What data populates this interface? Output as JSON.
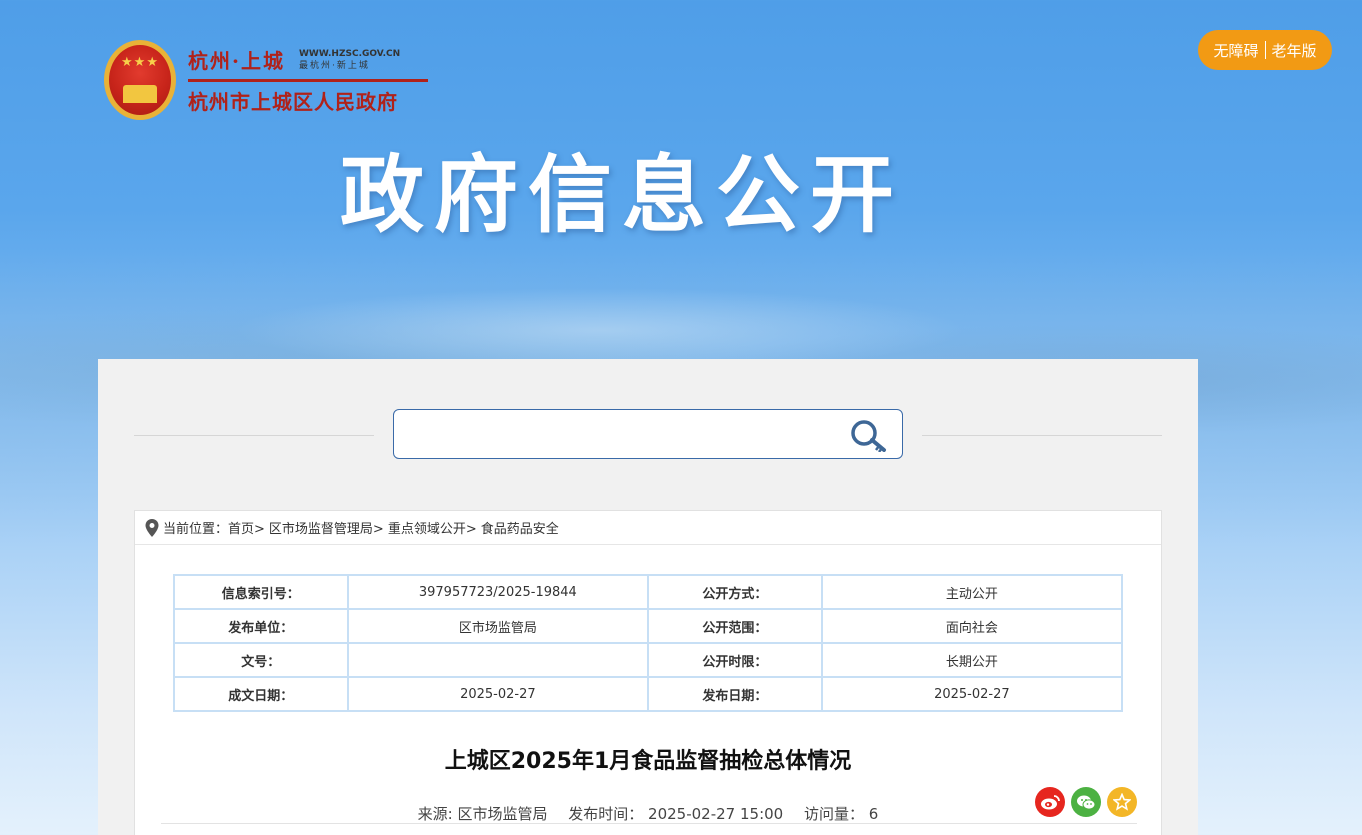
{
  "header": {
    "logo_short": "杭州·上城",
    "logo_url": "WWW.HZSC.GOV.CN",
    "logo_slogan": "最杭州·新上城",
    "logo_full": "杭州市上城区人民政府",
    "accessibility_label": "无障碍",
    "elder_label": "老年版",
    "banner_title": "政府信息公开"
  },
  "search": {
    "placeholder": ""
  },
  "breadcrumb": {
    "prefix": "当前位置：",
    "items": [
      "首页>",
      "区市场监督管理局>",
      "重点领域公开>",
      "食品药品安全"
    ]
  },
  "meta": {
    "rows": [
      {
        "k1": "信息索引号：",
        "v1": "397957723/2025-19844",
        "k2": "公开方式：",
        "v2": "主动公开"
      },
      {
        "k1": "发布单位：",
        "v1": "区市场监管局",
        "k2": "公开范围：",
        "v2": "面向社会"
      },
      {
        "k1": "文号：",
        "v1": "",
        "k2": "公开时限：",
        "v2": "长期公开"
      },
      {
        "k1": "成文日期：",
        "v1": "2025-02-27",
        "k2": "发布日期：",
        "v2": "2025-02-27"
      }
    ]
  },
  "article": {
    "title": "上城区2025年1月食品监督抽检总体情况",
    "source": "来源: 区市场监管局",
    "publish_time": "发布时间： 2025-02-27 15:00",
    "views": "访问量： 6"
  },
  "share": {
    "weibo_icon": "weibo-icon",
    "wechat_icon": "wechat-icon",
    "favorite_icon": "favorite-icon"
  }
}
